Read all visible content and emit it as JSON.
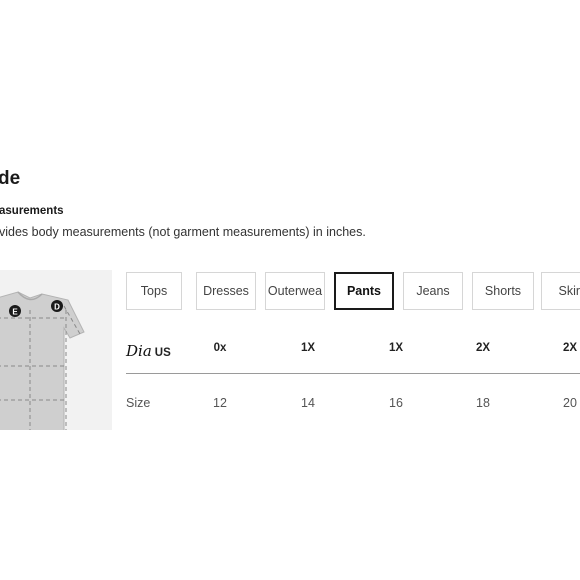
{
  "page": {
    "title": "de",
    "section_heading": "asurements",
    "description": "vides body measurements (not garment measurements) in inches."
  },
  "illustration": {
    "markers": [
      "E",
      "D"
    ]
  },
  "tabs": [
    {
      "label": "Tops",
      "active": false
    },
    {
      "label": "Dresses",
      "active": false
    },
    {
      "label": "Outerwea",
      "active": false
    },
    {
      "label": "Pants",
      "active": true
    },
    {
      "label": "Jeans",
      "active": false
    },
    {
      "label": "Shorts",
      "active": false
    },
    {
      "label": "Skirt",
      "active": false
    }
  ],
  "size_table": {
    "brand": "Dia",
    "us_label": "US",
    "us_sizes": [
      "0x",
      "1X",
      "1X",
      "2X",
      "2X"
    ],
    "size_label": "Size",
    "sizes": [
      "12",
      "14",
      "16",
      "18",
      "20"
    ]
  }
}
